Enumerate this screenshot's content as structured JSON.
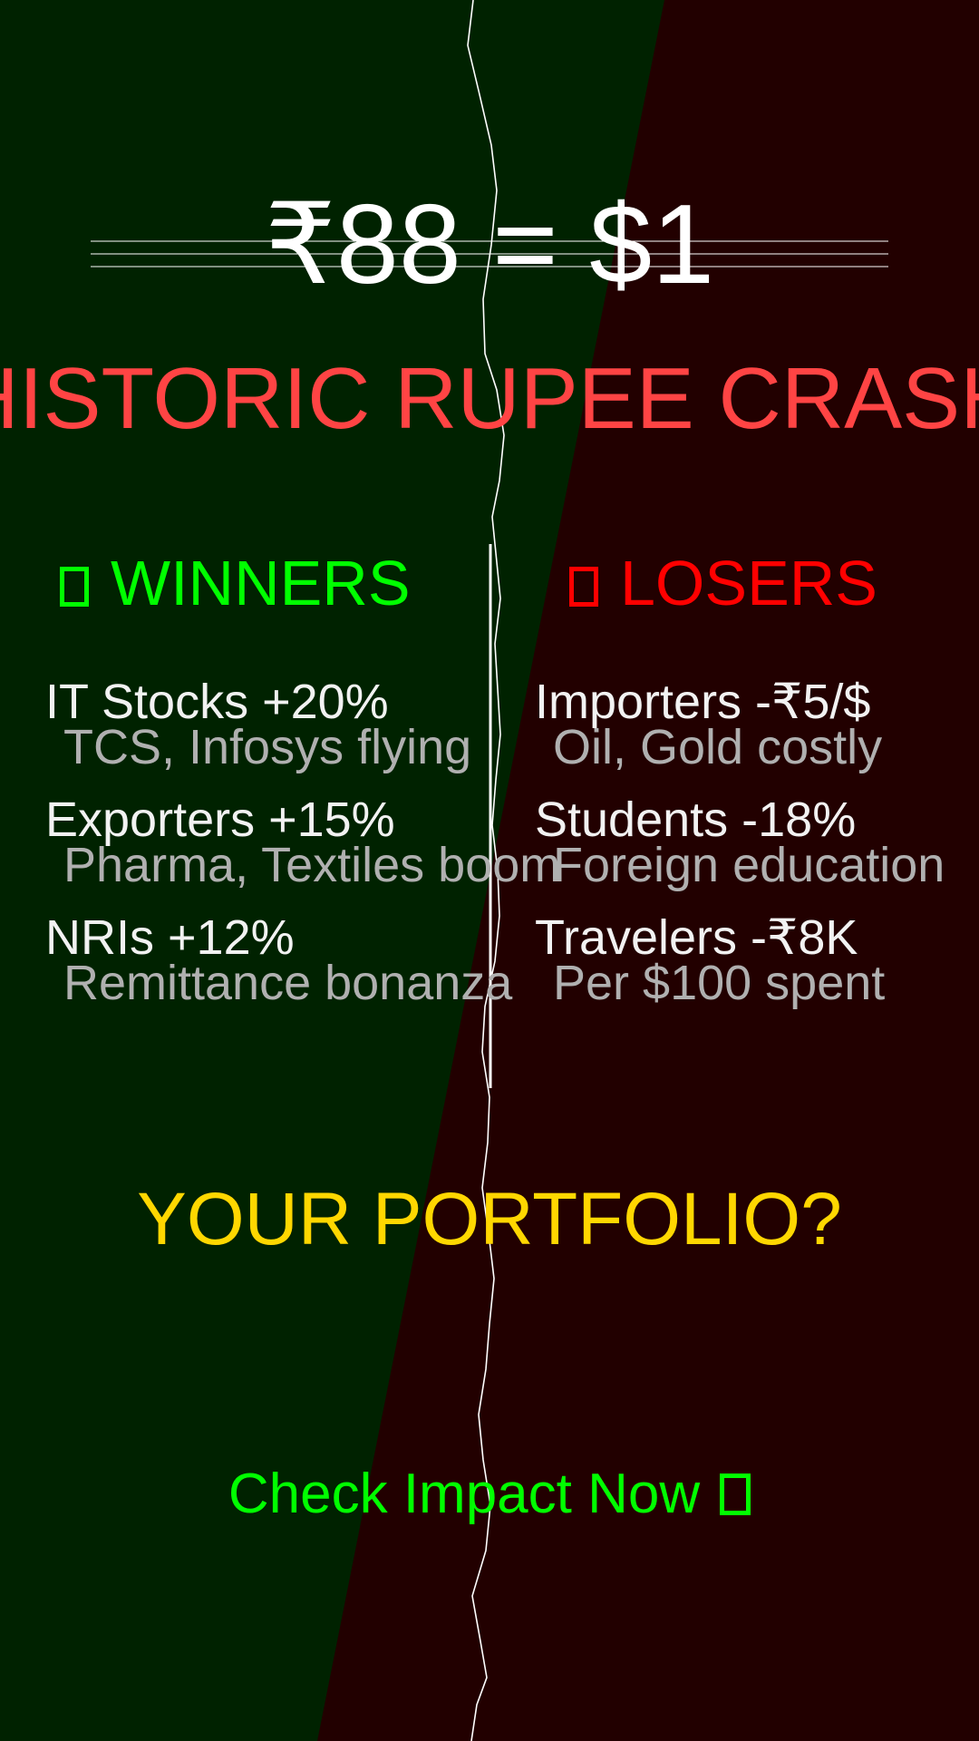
{
  "colors": {
    "winners_bg": "#002200",
    "losers_bg": "#220000",
    "headline": "#ffffff",
    "banner": "#ff4444",
    "winners_accent": "#00ff00",
    "losers_accent": "#ff0000",
    "item_title": "#f2f2f2",
    "item_sub": "#b0b0b0",
    "question": "#ffd700",
    "cta": "#00ff00"
  },
  "headline": "₹88 = $1",
  "banner": "HISTORIC RUPEE CRASH",
  "winners": {
    "heading": "WINNERS",
    "icon": "box-icon",
    "items": [
      {
        "title": "IT Stocks +20%",
        "sub": "TCS, Infosys flying"
      },
      {
        "title": "Exporters +15%",
        "sub": "Pharma, Textiles boom"
      },
      {
        "title": "NRIs +12%",
        "sub": "Remittance bonanza"
      }
    ]
  },
  "losers": {
    "heading": "LOSERS",
    "icon": "box-icon",
    "items": [
      {
        "title": "Importers -₹5/$",
        "sub": "Oil, Gold costly"
      },
      {
        "title": "Students -18%",
        "sub": "Foreign education"
      },
      {
        "title": "Travelers -₹8K",
        "sub": "Per $100 spent"
      }
    ]
  },
  "question": "YOUR PORTFOLIO?",
  "cta": {
    "label": "Check Impact Now",
    "icon": "box-icon"
  }
}
